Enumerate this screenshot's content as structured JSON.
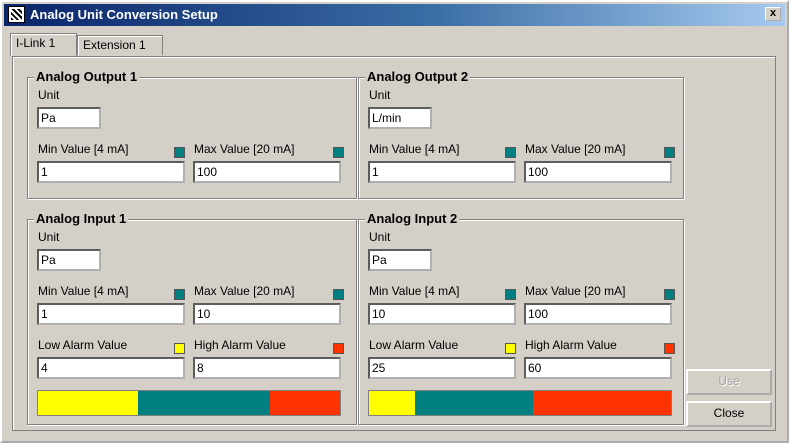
{
  "window": {
    "title": "Analog Unit Conversion Setup",
    "close_label": "x"
  },
  "tabs": [
    {
      "label": "I-Link 1",
      "active": true
    },
    {
      "label": "Extension 1",
      "active": false
    }
  ],
  "colors": {
    "min": "#008080",
    "max": "#008080",
    "low_alarm": "#ffff00",
    "high_alarm": "#ff3300",
    "bar_low": "#ffff00",
    "bar_mid": "#008080",
    "bar_high": "#ff3300"
  },
  "outputs": [
    {
      "title": "Analog Output 1",
      "unit_label": "Unit",
      "unit": "Pa",
      "min_label": "Min Value [4 mA]",
      "min": "1",
      "max_label": "Max Value [20 mA]",
      "max": "100"
    },
    {
      "title": "Analog Output 2",
      "unit_label": "Unit",
      "unit": "L/min",
      "min_label": "Min Value [4 mA]",
      "min": "1",
      "max_label": "Max Value [20 mA]",
      "max": "100"
    }
  ],
  "inputs": [
    {
      "title": "Analog Input 1",
      "unit_label": "Unit",
      "unit": "Pa",
      "min_label": "Min Value [4 mA]",
      "min": "1",
      "max_label": "Max Value [20 mA]",
      "max": "10",
      "low_label": "Low Alarm Value",
      "low": "4",
      "high_label": "High Alarm Value",
      "high": "8"
    },
    {
      "title": "Analog Input 2",
      "unit_label": "Unit",
      "unit": "Pa",
      "min_label": "Min Value [4 mA]",
      "min": "10",
      "max_label": "Max Value [20 mA]",
      "max": "100",
      "low_label": "Low Alarm Value",
      "low": "25",
      "high_label": "High Alarm Value",
      "high": "60"
    }
  ],
  "buttons": {
    "use_label": "Use",
    "close_label": "Close"
  }
}
